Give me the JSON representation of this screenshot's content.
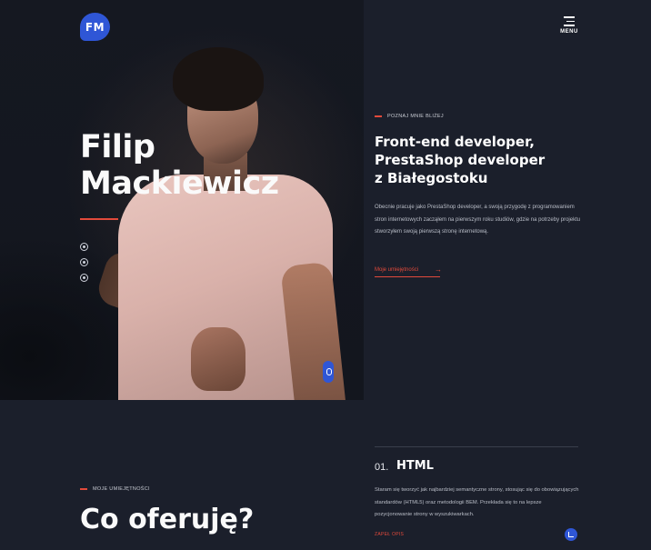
{
  "header": {
    "logo_text": "FM",
    "menu_label": "MENU"
  },
  "hero": {
    "name_line1": "Filip",
    "name_line2": "Mackiewicz",
    "social_icons": [
      "instagram-icon",
      "messenger-icon",
      "facebook-icon"
    ]
  },
  "intro": {
    "eyebrow": "POZNAJ MNIE BLIŻEJ",
    "title_line1": "Front-end developer,",
    "title_line2": "PrestaShop developer",
    "title_line3": "z Białegostoku",
    "paragraph": "Obecnie pracuje jako PrestaShop developer, a swoją przygodę z programowaniem stron internetowych zacząłem na pierwszym roku studiów, gdzie na potrzeby projektu stworzyłem swoją pierwszą stronę internetową.",
    "link_text": "Moje umiejętności"
  },
  "skills": {
    "eyebrow": "MOJE UMIEJĘTNOŚCI",
    "title": "Co oferuję?",
    "card": {
      "number": "01.",
      "title": "HTML",
      "text": "Staram się tworzyć jak najbardziej semantyczne strony, stosując się do obowiązujących standardów (HTML5) oraz metodologii BEM. Przekłada się to na lepsze pozycjonowanie strony w wyszukiwarkach.",
      "cta": "ZAPEŁ OPIS"
    }
  },
  "colors": {
    "background": "#1b1f2b",
    "accent_blue": "#2f56d6",
    "accent_red": "#e24a3b"
  }
}
